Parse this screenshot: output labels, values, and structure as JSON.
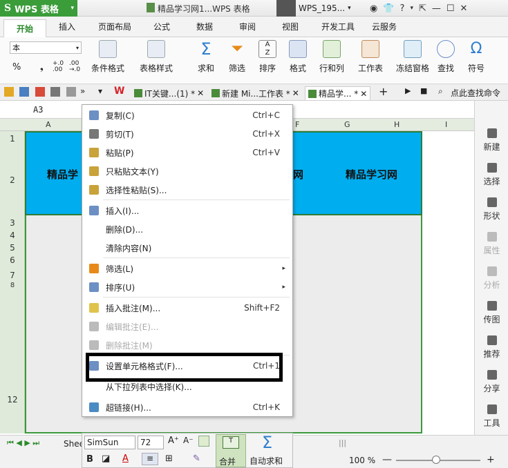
{
  "app": {
    "name": "WPS 表格",
    "logo": "S"
  },
  "title": {
    "document": "精品学习网1...WPS 表格",
    "user": "WPS_195..."
  },
  "ribbon_tabs": [
    "开始",
    "插入",
    "页面布局",
    "公式",
    "数据",
    "审阅",
    "视图",
    "开发工具",
    "云服务"
  ],
  "ribbon": {
    "font_name_value": "本",
    "percent": "%",
    "buttons": [
      "条件格式",
      "表格样式",
      "求和",
      "筛选",
      "排序",
      "格式",
      "行和列",
      "工作表",
      "冻结窗格",
      "查找",
      "符号"
    ]
  },
  "doc_tabs": [
    "IT关键...(1) *",
    "新建 Mi...工作表 *",
    "精品学... *"
  ],
  "find_command": "点此查找命令",
  "cell_ref": "A3",
  "columns": [
    "A",
    "F",
    "G",
    "H",
    "I"
  ],
  "rows": [
    "1",
    "2",
    "3",
    "4",
    "5",
    "6",
    "7",
    "8",
    "12"
  ],
  "cells": {
    "a2": "精品学",
    "f2": "网",
    "h2": "精品学习网"
  },
  "context_menu": [
    {
      "label": "复制(C)",
      "shortcut": "Ctrl+C"
    },
    {
      "label": "剪切(T)",
      "shortcut": "Ctrl+X"
    },
    {
      "label": "粘贴(P)",
      "shortcut": "Ctrl+V"
    },
    {
      "label": "只粘贴文本(Y)",
      "shortcut": ""
    },
    {
      "label": "选择性粘贴(S)...",
      "shortcut": ""
    },
    {
      "label": "插入(I)...",
      "shortcut": ""
    },
    {
      "label": "删除(D)...",
      "shortcut": ""
    },
    {
      "label": "清除内容(N)",
      "shortcut": ""
    },
    {
      "label": "筛选(L)",
      "shortcut": "▸"
    },
    {
      "label": "排序(U)",
      "shortcut": "▸"
    },
    {
      "label": "插入批注(M)...",
      "shortcut": "Shift+F2"
    },
    {
      "label": "编辑批注(E)...",
      "shortcut": ""
    },
    {
      "label": "删除批注(M)",
      "shortcut": ""
    },
    {
      "label": "设置单元格格式(F)...",
      "shortcut": "Ctrl+1"
    },
    {
      "label": "从下拉列表中选择(K)...",
      "shortcut": ""
    },
    {
      "label": "超链接(H)...",
      "shortcut": "Ctrl+K"
    }
  ],
  "right_panel": [
    "新建",
    "选择",
    "形状",
    "属性",
    "分析",
    "传图",
    "推荐",
    "分享",
    "工具"
  ],
  "status": {
    "sheet_label": "Shee",
    "zoom": "100 %"
  },
  "minibar": {
    "font": "SimSun",
    "size": "72",
    "merge": "合并",
    "autosum": "自动求和"
  }
}
